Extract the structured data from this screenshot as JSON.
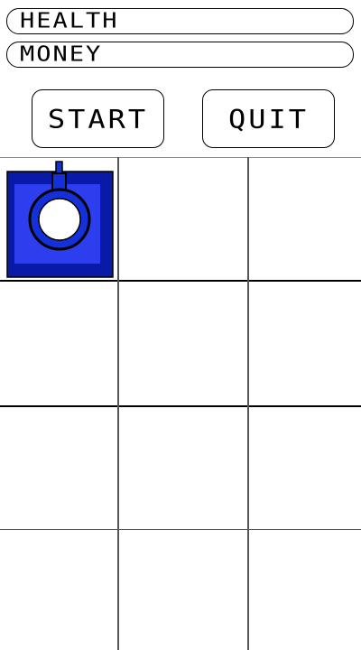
{
  "hud": {
    "health_label": "HEALTH",
    "money_label": "MONEY"
  },
  "controls": {
    "start_label": "START",
    "quit_label": "QUIT"
  },
  "board": {
    "rows": 4,
    "columns": 3,
    "towers": [
      {
        "row": 0,
        "column": 0,
        "type": "cannon-tower"
      }
    ]
  },
  "colors": {
    "background": "#ffffff",
    "tower_outer": "#0a1aa8",
    "tower_inner": "#2d3eee",
    "tower_barrel": "#1430d8",
    "tower_core": "#ffffff",
    "outline": "#000000"
  }
}
